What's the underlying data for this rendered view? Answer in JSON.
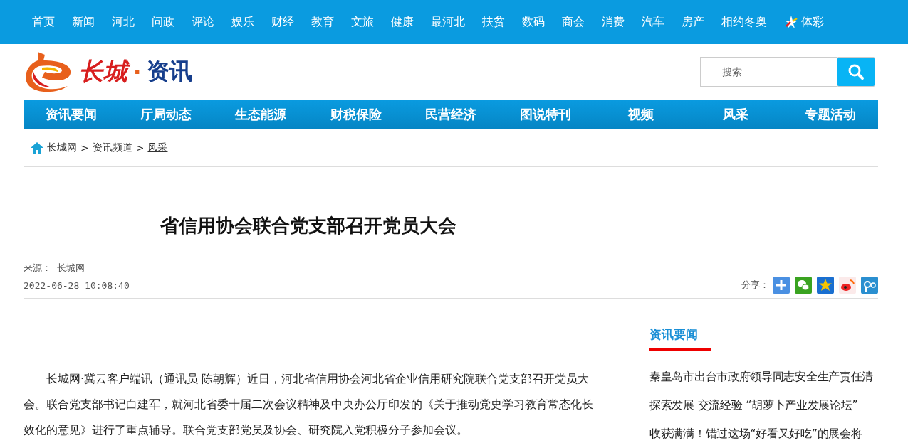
{
  "top_nav": [
    {
      "label": "首页"
    },
    {
      "label": "新闻"
    },
    {
      "label": "河北"
    },
    {
      "label": "问政"
    },
    {
      "label": "评论"
    },
    {
      "label": "娱乐"
    },
    {
      "label": "财经"
    },
    {
      "label": "教育"
    },
    {
      "label": "文旅"
    },
    {
      "label": "健康"
    },
    {
      "label": "最河北"
    },
    {
      "label": "扶贫"
    },
    {
      "label": "数码"
    },
    {
      "label": "商会"
    },
    {
      "label": "消费"
    },
    {
      "label": "汽车"
    },
    {
      "label": "房产"
    },
    {
      "label": "相约冬奥"
    },
    {
      "label": "体彩",
      "kind": "lottery"
    }
  ],
  "logo": {
    "brand": "长城",
    "dot": "·",
    "channel": "资讯"
  },
  "search": {
    "placeholder": "搜索"
  },
  "channel_nav": [
    "资讯要闻",
    "厅局动态",
    "生态能源",
    "财税保险",
    "民营经济",
    "图说特刊",
    "视频",
    "风采",
    "专题活动"
  ],
  "breadcrumb": [
    "长城网",
    "资讯频道",
    "风采"
  ],
  "breadcrumb_separator": ">",
  "article": {
    "title": "省信用协会联合党支部召开党员大会",
    "source_label": "来源：",
    "source": "长城网",
    "date": "2022-06-28 10:08:40",
    "share_label": "分享：",
    "body": "长城网·冀云客户端讯（通讯员 陈朝辉）近日，河北省信用协会河北省企业信用研究院联合党支部召开党员大会。联合党支部书记白建军，就河北省委十届二次会议精神及中央办公厅印发的《关于推动党史学习教育常态化长效化的意见》进行了重点辅导。联合党支部党员及协会、研究院入党积极分子参加会议。"
  },
  "sidebar": {
    "title": "资讯要闻",
    "items": [
      "秦皇岛市出台市政府领导同志安全生产责任清",
      "探索发展 交流经验 “胡萝卜产业发展论坛”",
      "收获满满！错过这场“好看又好吃”的展会将"
    ]
  }
}
